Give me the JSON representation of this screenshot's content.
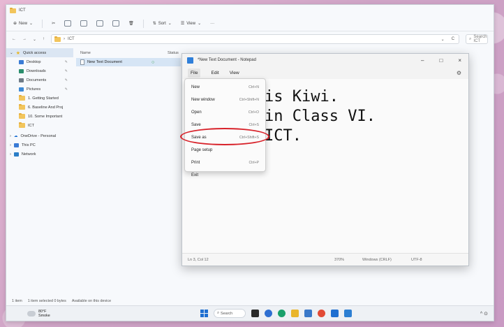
{
  "explorer": {
    "title": "ICT",
    "commands": {
      "new": "New",
      "sort": "Sort",
      "view": "View",
      "more": "···"
    },
    "address": {
      "nav_back": "←",
      "nav_forward": "→",
      "nav_recent": "⌄",
      "nav_up": "↑",
      "path_sep": "›",
      "path": "ICT",
      "dropdown": "⌄",
      "refresh": "C",
      "search_placeholder": "Search ICT"
    },
    "nav_pane": {
      "quick_access": "Quick access",
      "items": [
        {
          "label": "Desktop",
          "color": "#3a7bd5"
        },
        {
          "label": "Downloads",
          "color": "#2a8e6d"
        },
        {
          "label": "Documents",
          "color": "#6f7b87"
        },
        {
          "label": "Pictures",
          "color": "#3d8ad6"
        },
        {
          "label": "1. Getting Started",
          "color": "#f2c55c"
        },
        {
          "label": "6. Baseline And Proj",
          "color": "#f2c55c"
        },
        {
          "label": "10. Some Important",
          "color": "#f2c55c"
        },
        {
          "label": "ICT",
          "color": "#f2c55c"
        }
      ],
      "onedrive": "OneDrive - Personal",
      "this_pc": "This PC",
      "network": "Network"
    },
    "columns": {
      "name": "Name",
      "status": "Status"
    },
    "files": [
      {
        "name": "New Text Document"
      }
    ],
    "status_bar": {
      "items": "1 item",
      "selected": "1 item selected 0 bytes",
      "availability": "Available on this device"
    }
  },
  "notepad": {
    "title": "*New Text Document - Notepad",
    "menus": {
      "file": "File",
      "edit": "Edit",
      "view": "View"
    },
    "text_lines": [
      "is Kiwi.",
      "in Class VI.",
      "ICT."
    ],
    "file_menu": [
      {
        "label": "New",
        "shortcut": "Ctrl+N"
      },
      {
        "label": "New window",
        "shortcut": "Ctrl+Shift+N"
      },
      {
        "label": "Open",
        "shortcut": "Ctrl+O"
      },
      {
        "label": "Save",
        "shortcut": "Ctrl+S"
      },
      {
        "label": "Save as",
        "shortcut": "Ctrl+Shift+S"
      },
      {
        "label": "Page setup",
        "shortcut": ""
      },
      {
        "label": "Print",
        "shortcut": "Ctrl+P"
      },
      {
        "label": "Exit",
        "shortcut": ""
      }
    ],
    "status": {
      "position": "Ln 3, Col 12",
      "zoom": "370%",
      "line_ending": "Windows (CRLF)",
      "encoding": "UTF-8"
    },
    "window_controls": {
      "minimize": "–",
      "maximize": "□",
      "close": "×"
    }
  },
  "taskbar": {
    "weather_temp": "80°F",
    "weather_desc": "Smoke",
    "search_label": "Search",
    "icon_colors": [
      "#2a2a2a",
      "#2f6fd1",
      "#1aa06b",
      "#e9b52c",
      "#3a78c9",
      "#e24b36",
      "#1f6fd1",
      "#2d7fd3"
    ],
    "tray": "^ ⊙"
  },
  "highlight_color": "#d8222a"
}
